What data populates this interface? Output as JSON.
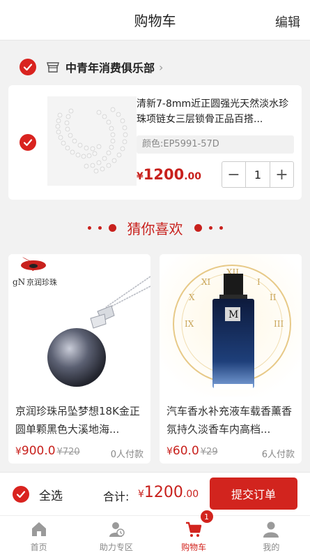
{
  "header": {
    "title": "购物车",
    "edit_label": "编辑"
  },
  "shop": {
    "name": "中青年消费俱乐部"
  },
  "cart_item": {
    "name": "清新7-8mm近正圆强光天然淡水珍珠项链女三层锁骨正品百搭...",
    "spec": "颜色:EP5991-57D",
    "price_currency": "¥",
    "price_int": "1200",
    "price_dec": ".00",
    "quantity": "1",
    "minus": "−",
    "plus": "+"
  },
  "guess_title": "猜你喜欢",
  "recommendations": [
    {
      "name": "京润珍珠吊坠梦想18K金正圆单颗黑色大溪地海...",
      "currency": "¥",
      "price": "900.0",
      "old_price": "¥720",
      "paid": "0人付款",
      "brand_text": "京润珍珠",
      "brand_prefix": "gN"
    },
    {
      "name": "汽车香水补充液车载香薰香氛持久淡香车内高档...",
      "currency": "¥",
      "price": "60.0",
      "old_price": "¥29",
      "paid": "6人付款"
    }
  ],
  "checkout": {
    "select_all": "全选",
    "total_label": "合计:",
    "total_currency": "¥",
    "total_int": "1200",
    "total_dec": ".00",
    "submit_label": "提交订单"
  },
  "tabs": [
    {
      "label": "首页",
      "icon": "home-icon"
    },
    {
      "label": "助力专区",
      "icon": "assist-icon"
    },
    {
      "label": "购物车",
      "icon": "cart-icon",
      "badge": "1",
      "active": true
    },
    {
      "label": "我的",
      "icon": "user-icon"
    }
  ],
  "colors": {
    "accent": "#d2241e",
    "price": "#c8211d",
    "background": "#f2f2f2"
  }
}
